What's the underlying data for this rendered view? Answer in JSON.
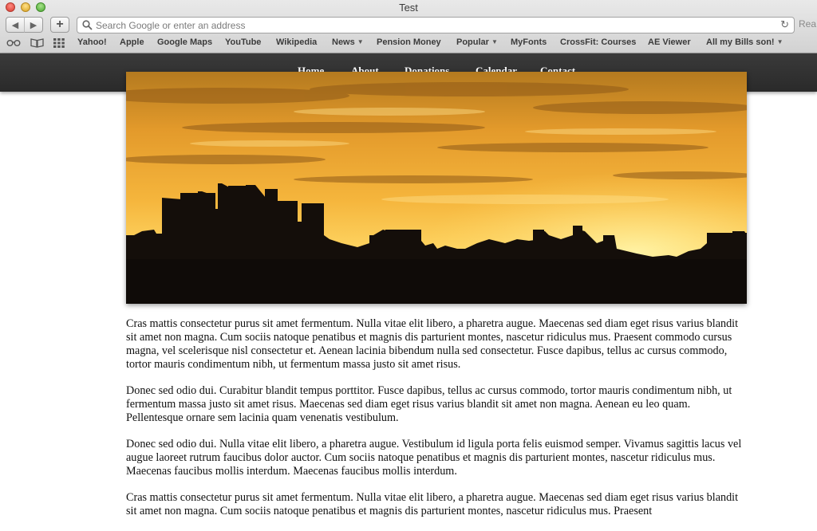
{
  "window": {
    "title": "Test"
  },
  "toolbar": {
    "address_placeholder": "Search Google or enter an address",
    "reader_label": "Rea"
  },
  "bookmarks": [
    {
      "label": "Yahoo!"
    },
    {
      "label": "Apple"
    },
    {
      "label": "Google Maps"
    },
    {
      "label": "YouTube"
    },
    {
      "label": "Wikipedia"
    },
    {
      "label": "News"
    },
    {
      "label": "Pension Money"
    },
    {
      "label": "Popular"
    },
    {
      "label": "MyFonts"
    },
    {
      "label": "CrossFit: Courses"
    },
    {
      "label": "AE Viewer"
    },
    {
      "label": "All my Bills son!"
    }
  ],
  "nav": {
    "items": [
      "Home",
      "About",
      "Donations",
      "Calendar",
      "Contact"
    ]
  },
  "content": {
    "paragraphs": [
      "Cras mattis consectetur purus sit amet fermentum. Nulla vitae elit libero, a pharetra augue. Maecenas sed diam eget risus varius blandit sit amet non magna. Cum sociis natoque penatibus et magnis dis parturient montes, nascetur ridiculus mus. Praesent commodo cursus magna, vel scelerisque nisl consectetur et. Aenean lacinia bibendum nulla sed consectetur. Fusce dapibus, tellus ac cursus commodo, tortor mauris condimentum nibh, ut fermentum massa justo sit amet risus.",
      "Donec sed odio dui. Curabitur blandit tempus porttitor. Fusce dapibus, tellus ac cursus commodo, tortor mauris condimentum nibh, ut fermentum massa justo sit amet risus. Maecenas sed diam eget risus varius blandit sit amet non magna. Aenean eu leo quam. Pellentesque ornare sem lacinia quam venenatis vestibulum.",
      "Donec sed odio dui. Nulla vitae elit libero, a pharetra augue. Vestibulum id ligula porta felis euismod semper. Vivamus sagittis lacus vel augue laoreet rutrum faucibus dolor auctor. Cum sociis natoque penatibus et magnis dis parturient montes, nascetur ridiculus mus. Maecenas faucibus mollis interdum. Maecenas faucibus mollis interdum.",
      "Cras mattis consectetur purus sit amet fermentum. Nulla vitae elit libero, a pharetra augue. Maecenas sed diam eget risus varius blandit sit amet non magna. Cum sociis natoque penatibus et magnis dis parturient montes, nascetur ridiculus mus. Praesent"
    ]
  },
  "colors": {
    "nav_bg": "#2f2f2f",
    "sky_top": "#c98a1e",
    "sky_bright": "#ffd45a",
    "skyline": "#120d0a"
  }
}
